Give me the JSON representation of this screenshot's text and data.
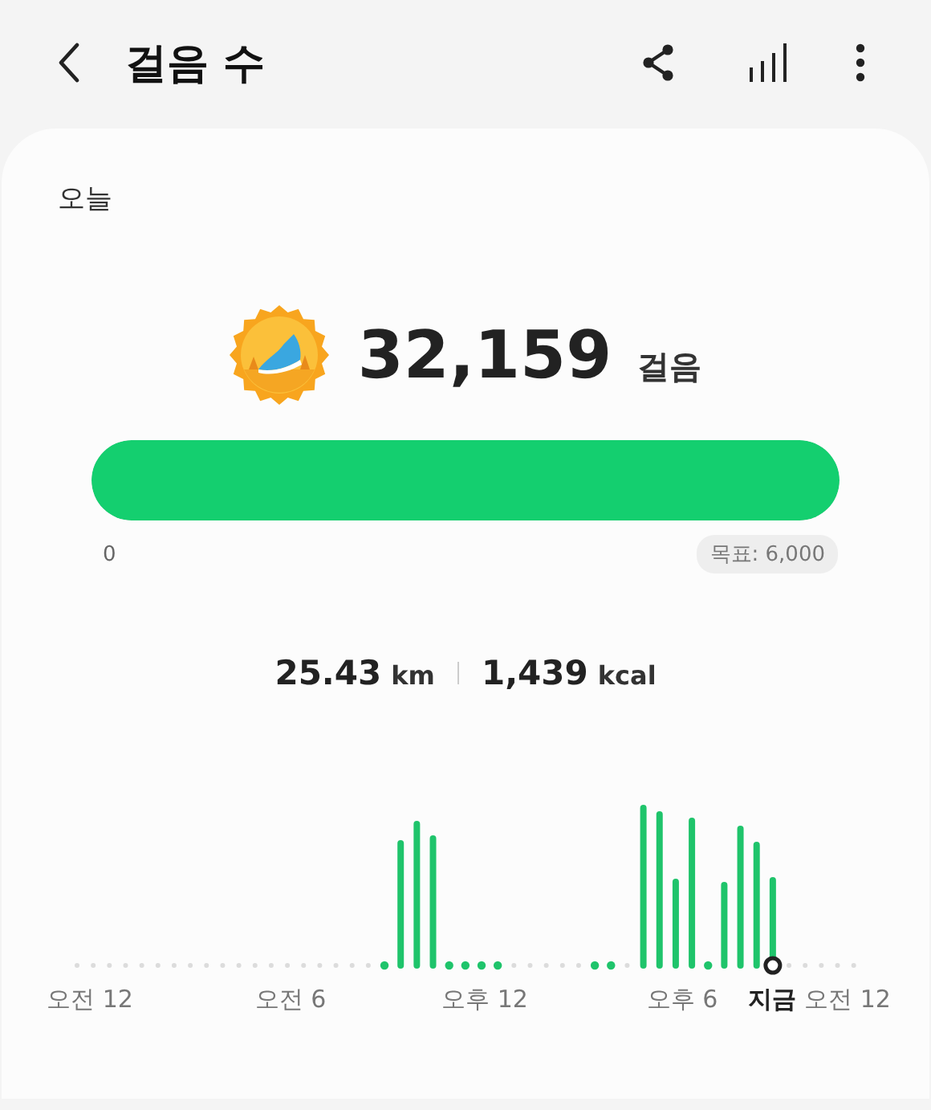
{
  "header": {
    "title": "걸음 수"
  },
  "card": {
    "period": "오늘",
    "steps": "32,159",
    "steps_unit": "걸음",
    "progress": {
      "level": 1,
      "start_label": "0",
      "goal_label": "목표: 6,000"
    },
    "stats": [
      {
        "value": "25.43",
        "unit": "km"
      },
      {
        "value": "1,439",
        "unit": "kcal"
      }
    ],
    "chart": {
      "x_labels": [
        {
          "label": "오전 12",
          "current": false
        },
        {
          "label": "오전 6",
          "current": false
        },
        {
          "label": "오후 12",
          "current": false
        },
        {
          "label": "오후 6",
          "current": false
        },
        {
          "label": "지금",
          "current": true
        },
        {
          "label": "오전 12",
          "current": false
        }
      ]
    }
  }
}
